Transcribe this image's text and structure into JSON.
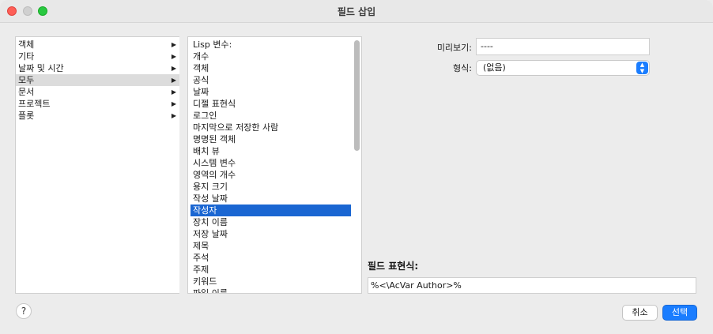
{
  "window": {
    "title": "필드 삽입"
  },
  "categories": [
    {
      "label": "객체",
      "has_submenu": true
    },
    {
      "label": "기타",
      "has_submenu": true
    },
    {
      "label": "날짜 및 시간",
      "has_submenu": true
    },
    {
      "label": "모두",
      "has_submenu": true,
      "selected": true
    },
    {
      "label": "문서",
      "has_submenu": true
    },
    {
      "label": "프로젝트",
      "has_submenu": true
    },
    {
      "label": "플롯",
      "has_submenu": true
    }
  ],
  "fields": [
    "Lisp 변수:",
    "개수",
    "객체",
    "공식",
    "날짜",
    "디젤 표현식",
    "로그인",
    "마지막으로 저장한 사람",
    "명명된 객체",
    "배치 뷰",
    "시스템 변수",
    "영역의 개수",
    "용지 크기",
    "작성 날짜",
    "작성자",
    "장치 이름",
    "저장 날짜",
    "제목",
    "주석",
    "주제",
    "키워드",
    "파일 이름"
  ],
  "selected_field": "작성자",
  "preview": {
    "label": "미리보기:",
    "value": "----"
  },
  "format": {
    "label": "형식:",
    "value": "(없음)"
  },
  "expression": {
    "label": "필드 표현식:",
    "value": "%<\\AcVar Author>%"
  },
  "buttons": {
    "help": "?",
    "cancel": "취소",
    "ok": "선택"
  },
  "icons": {
    "arrow": "right-triangle",
    "select_arrows": "up-down-chevron"
  },
  "colors": {
    "selection": "#1a66d2",
    "accent": "#1a7dff"
  }
}
